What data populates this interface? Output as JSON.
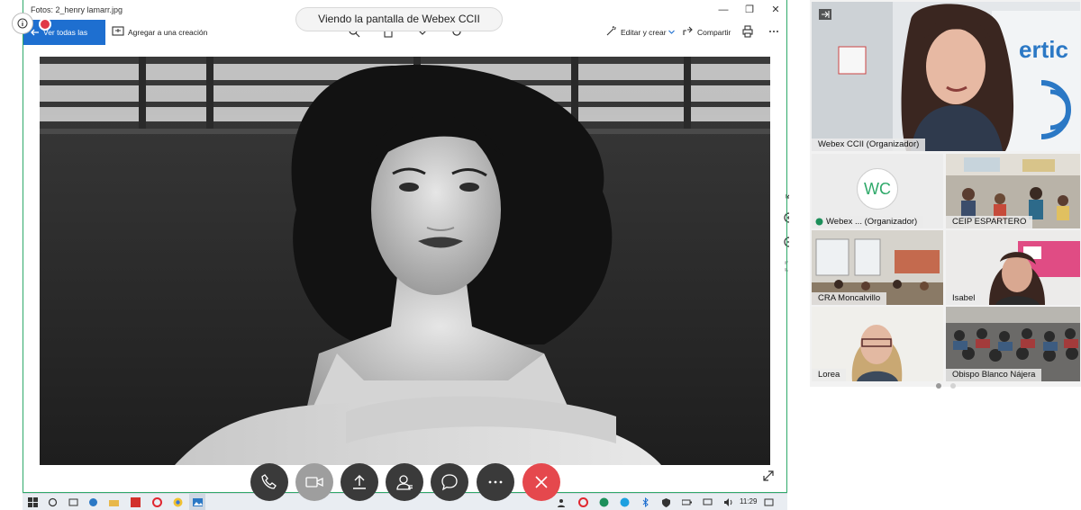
{
  "shared_screen": {
    "window_title": "Fotos: 2_henry lamarr.jpg",
    "banner_text": "Viendo la pantalla de Webex CCII",
    "toolbar": {
      "all_photos_label": "Ver todas las fotos",
      "add_creation_label": "Agregar a una creación",
      "edit_create_label": "Editar y crear",
      "share_label": "Compartir"
    },
    "window_controls": [
      "—",
      "❐",
      "✕"
    ],
    "taskbar": {
      "time": "11:29"
    }
  },
  "call_controls": [
    {
      "name": "phone",
      "icon": "phone-icon"
    },
    {
      "name": "video",
      "icon": "video-icon"
    },
    {
      "name": "share",
      "icon": "share-upload-icon"
    },
    {
      "name": "participants",
      "icon": "participants-icon"
    },
    {
      "name": "chat",
      "icon": "chat-icon"
    },
    {
      "name": "more",
      "icon": "more-icon"
    },
    {
      "name": "end-call",
      "icon": "close-icon"
    }
  ],
  "participants_panel": {
    "speaker": {
      "name": "Webex CCII (Organizador)",
      "sign_text": "ertic"
    },
    "tiles": [
      {
        "label": "Webex ...  (Organizador)",
        "avatar_initials": "WC"
      },
      {
        "label": "CEIP ESPARTERO"
      },
      {
        "label": "CRA Moncalvillo"
      },
      {
        "label": "Isabel"
      },
      {
        "label": "Lorea"
      },
      {
        "label": "Obispo Blanco Nájera"
      }
    ]
  },
  "colors": {
    "accent_blue": "#1e6fd0",
    "end_call_red": "#e5484d",
    "webex_green": "#2fa96a",
    "control_dark": "#3a3a3a"
  }
}
